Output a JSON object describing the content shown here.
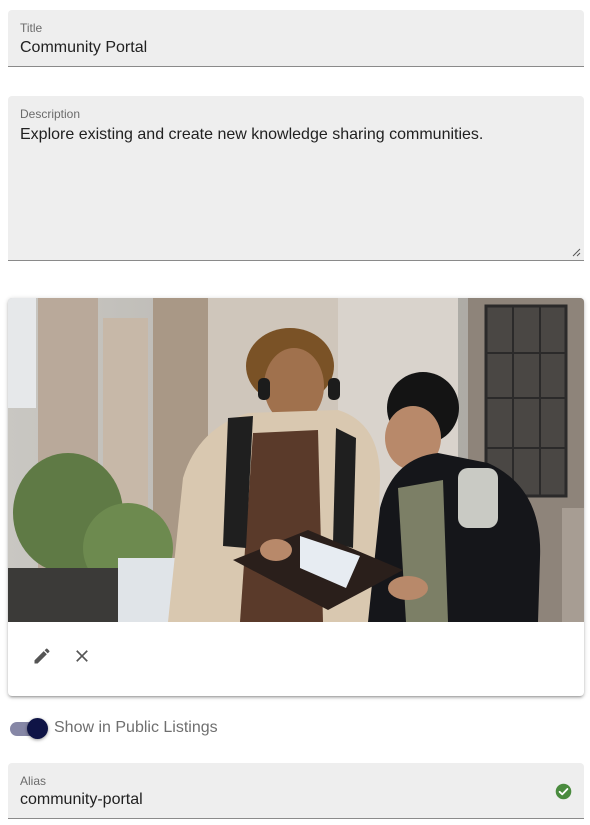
{
  "title_field": {
    "label": "Title",
    "value": "Community Portal"
  },
  "description_field": {
    "label": "Description",
    "value": "Explore existing and create new knowledge sharing communities."
  },
  "image_card": {
    "edit_icon": "pencil-icon",
    "remove_icon": "close-icon"
  },
  "public_listing_toggle": {
    "label": "Show in Public Listings",
    "checked": true
  },
  "alias_field": {
    "label": "Alias",
    "value": "community-portal",
    "status_icon": "check-circle-icon"
  },
  "colors": {
    "field_bg": "#eeeeee",
    "toggle_thumb": "#0f1446",
    "toggle_track": "#8687a6",
    "valid_green": "#4a8b3f"
  }
}
